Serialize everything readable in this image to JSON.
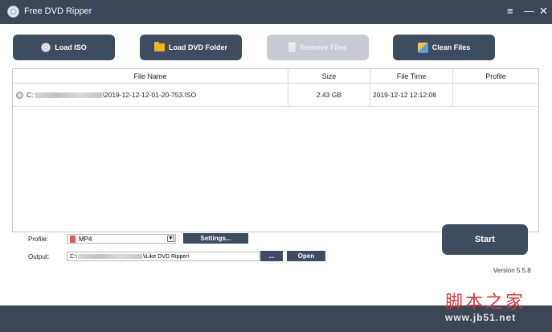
{
  "window": {
    "title": "Free DVD Ripper",
    "controls": {
      "menu": "≡",
      "minimize": "—",
      "close": "✕"
    }
  },
  "toolbar": {
    "load_iso": "Load ISO",
    "load_dvd_folder": "Load DVD Folder",
    "remove_files": "Remove Files",
    "clean_files": "Clean Files"
  },
  "file_table": {
    "columns": [
      "File Name",
      "Size",
      "File Time",
      "Profile"
    ],
    "rows": [
      {
        "name_prefix": "C:",
        "name_suffix": "\\2019-12-12-12-01-20-753.ISO",
        "size": "2.43 GB",
        "time": "2019-12-12 12:12:08",
        "profile": ""
      }
    ]
  },
  "settings": {
    "profile_label": "Profile:",
    "profile_value": "MP4",
    "settings_button": "Settings...",
    "output_label": "Output:",
    "output_prefix": "C:\\",
    "output_suffix": "\\iLike DVD Ripper\\",
    "browse_button": "...",
    "open_button": "Open"
  },
  "start_button": "Start",
  "version": "Version 5.5.8",
  "watermark": {
    "main": "脚本之家",
    "sub": "www.jb51.net"
  },
  "colors": {
    "titlebar": "#3d4656",
    "button": "#3e4c60",
    "button_disabled": "#c8cbd0",
    "watermark_red": "#d23a3a"
  }
}
